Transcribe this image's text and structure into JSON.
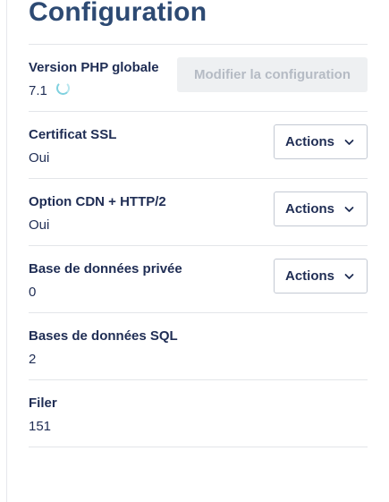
{
  "page": {
    "title": "Configuration"
  },
  "rows": [
    {
      "label": "Version PHP globale",
      "value": "7.1",
      "button": "Modifier la configuration"
    },
    {
      "label": "Certificat SSL",
      "value": "Oui",
      "button": "Actions"
    },
    {
      "label": "Option CDN + HTTP/2",
      "value": "Oui",
      "button": "Actions"
    },
    {
      "label": "Base de données privée",
      "value": "0",
      "button": "Actions"
    },
    {
      "label": "Bases de données SQL",
      "value": "2"
    },
    {
      "label": "Filer",
      "value": "151"
    }
  ],
  "icons": {
    "loading": "spinner-icon",
    "dropdown": "chevron-down-icon"
  },
  "colors": {
    "title": "#2d4a73",
    "text": "#1f2d54",
    "spinner": "#7fd1df",
    "disabled_bg": "#eef0f2",
    "disabled_text": "#b5bbc4"
  }
}
